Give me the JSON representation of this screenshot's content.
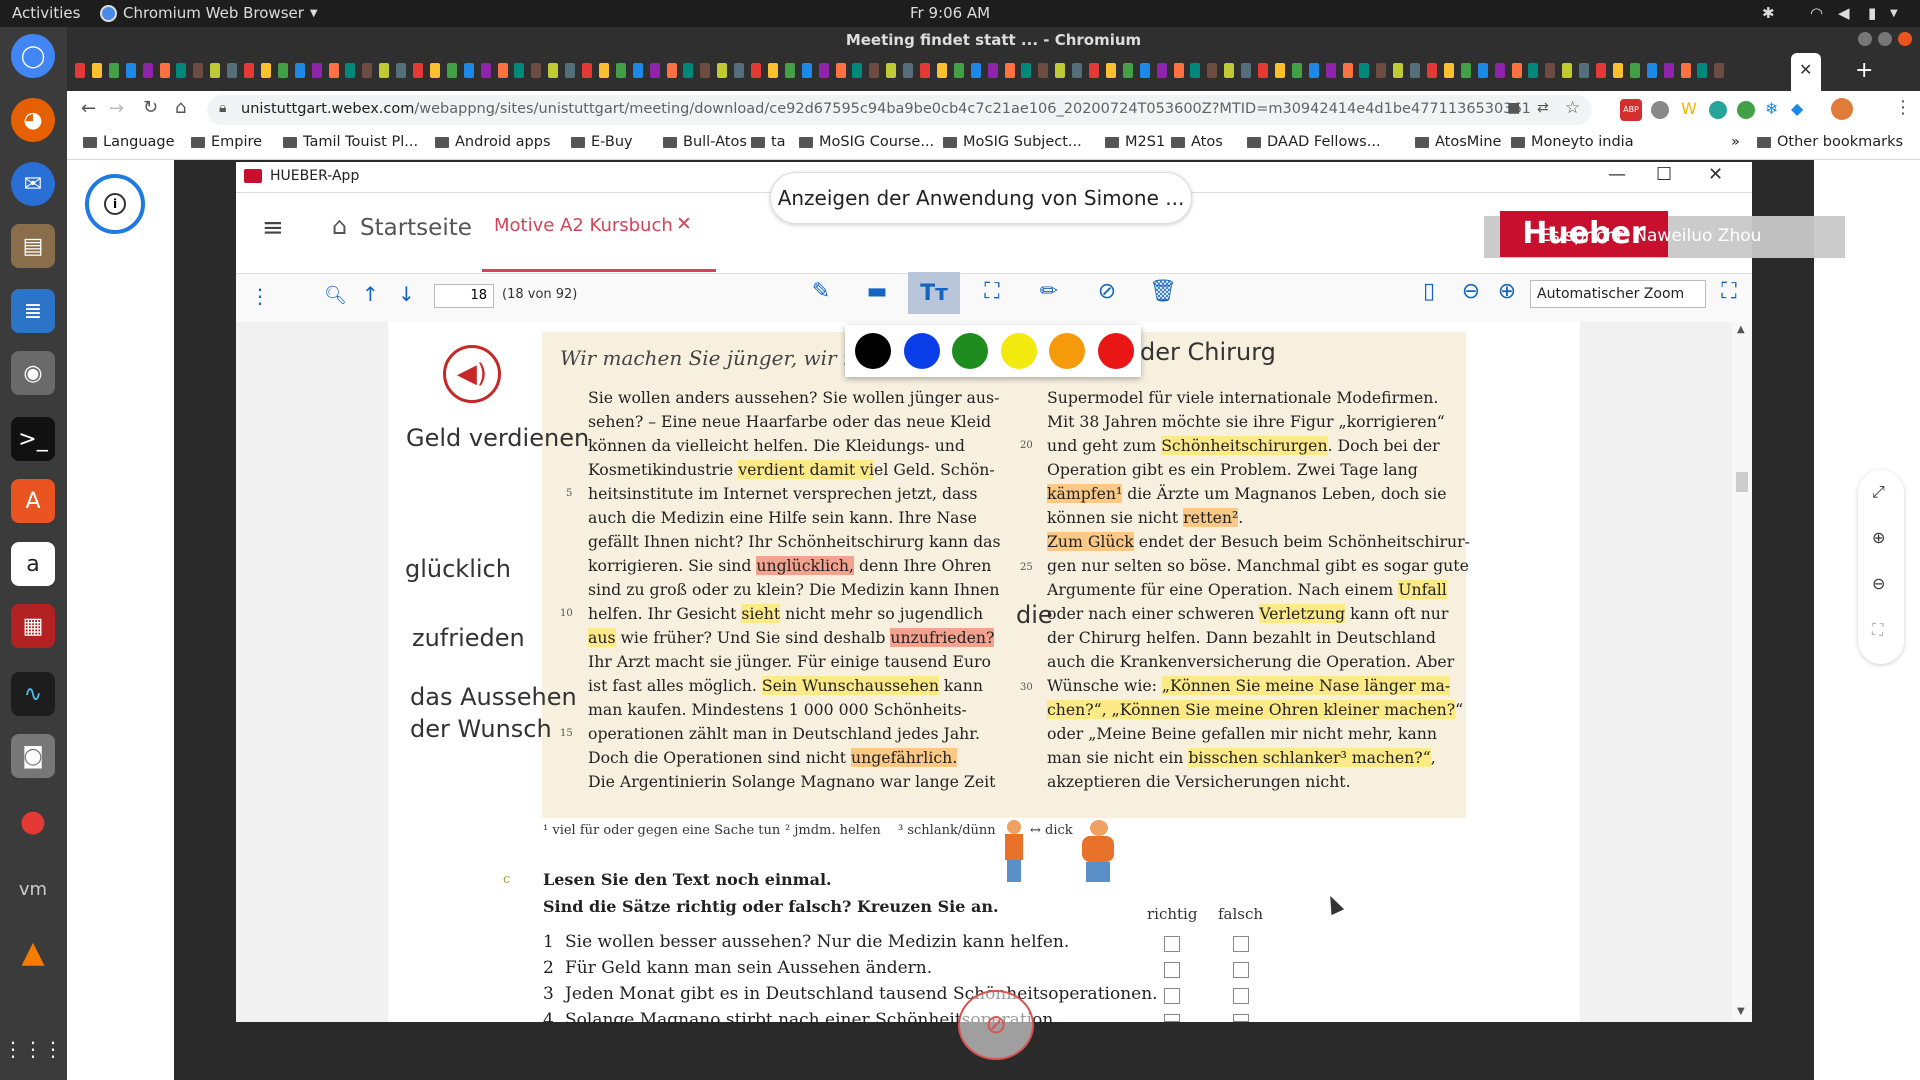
{
  "system_bar": {
    "activities": "Activities",
    "app_menu": "Chromium Web Browser",
    "clock": "Fr  9:06 AM"
  },
  "browser": {
    "window_title": "Meeting findet statt ... - Chromium",
    "url_domain": "unistuttgart.webex.com",
    "url_path": "/webappng/sites/unistuttgart/meeting/download/ce92d67595c94ba9be0cb4c7c21ae106_20200724T053600Z?MTID=m30942414e4d1be477113653036162165&launchApp...",
    "bookmarks": [
      "Language",
      "Empire",
      "Tamil Touist Pl...",
      "Android apps",
      "E-Buy",
      "Bull-Atos",
      "ta",
      "MoSIG Course...",
      "MoSIG Subject...",
      "M2S1",
      "Atos",
      "DAAD Fellows...",
      "AtosMine",
      "Moneyto india"
    ],
    "more_bookmarks": "»",
    "other_bookmarks": "Other bookmarks"
  },
  "webex": {
    "share_banner": "Anzeigen der Anwendung von Simone ...",
    "speaking": "Es spricht: Naweiluo Zhou",
    "hueber_badge": "Hueber",
    "info_icon": "i"
  },
  "app": {
    "window_title": "HUEBER-App",
    "home": "Startseite",
    "tab_label": "Motive A2 Kursbuch",
    "page_number": "18",
    "page_count": "(18 von 92)",
    "zoom": "Automatischer Zoom",
    "color_swatches": [
      "#000000",
      "#0a3ee8",
      "#1e8c1e",
      "#f2ea0f",
      "#f59a0a",
      "#ea1515"
    ]
  },
  "document": {
    "heading_left": "Wir machen Sie jünger, wir m",
    "heading_right": "der Chirurg",
    "side_words": [
      "Geld verdienen",
      "glücklich",
      "zufrieden",
      "das Aussehen",
      "der Wunsch",
      "die"
    ],
    "left_lines": [
      "Sie wollen anders aussehen? Sie wollen jünger aus-",
      "sehen? – Eine neue Haarfarbe oder das neue Kleid",
      "können da vielleicht helfen. Die Kleidungs- und",
      "Kosmetikindustrie verdient damit viel Geld. Schön-",
      "heitsinstitute im Internet versprechen jetzt, dass",
      "auch die Medizin eine Hilfe sein kann. Ihre Nase",
      "gefällt Ihnen nicht? Ihr Schönheitschirurg kann das",
      "korrigieren. Sie sind unglücklich, denn Ihre Ohren",
      "sind zu groß oder zu klein? Die Medizin kann Ihnen",
      "helfen. Ihr Gesicht sieht nicht mehr so jugendlich",
      "aus wie früher? Und Sie sind deshalb unzufrieden?",
      "Ihr Arzt macht sie jünger. Für einige tausend Euro",
      "ist fast alles möglich. Sein Wunschaussehen kann",
      "man kaufen. Mindestens 1 000 000 Schönheits-",
      "operationen zählt man in Deutschland jedes Jahr.",
      "Doch die Operationen sind nicht ungefährlich.",
      "Die Argentinierin Solange Magnano war lange Zeit"
    ],
    "right_lines": [
      "Supermodel für viele internationale Modefirmen.",
      "Mit 38 Jahren möchte sie ihre Figur „korrigieren“",
      "und geht zum Schönheitschirurgen. Doch bei der",
      "Operation gibt es ein Problem. Zwei Tage lang",
      "kämpfen¹ die Ärzte um Magnanos Leben, doch sie",
      "können sie nicht retten².",
      "Zum Glück endet der Besuch beim Schönheitschirur-",
      "gen nur selten so böse. Manchmal gibt es sogar gute",
      "Argumente für eine Operation. Nach einem Unfall",
      "oder nach einer schweren Verletzung kann oft nur",
      "der Chirurg helfen. Dann bezahlt in Deutschland",
      "auch die Krankenversicherung die Operation. Aber",
      "Wünsche wie: „Können Sie meine Nase länger ma-",
      "chen?“, „Können Sie meine Ohren kleiner machen?“",
      "oder „Meine Beine gefallen mir nicht mehr, kann",
      "man sie nicht ein bisschen schlanker³ machen?“,",
      "akzeptieren die Versicherungen nicht."
    ],
    "line_numbers_left": [
      "5",
      "10",
      "15"
    ],
    "line_numbers_right": [
      "20",
      "25",
      "30"
    ],
    "footnote1": "¹ viel für oder gegen eine Sache tun",
    "footnote2": "² jmdm. helfen",
    "footnote3": "³ schlank/dünn",
    "footnote_arrow": "↔ dick",
    "exercise_letter": "c",
    "exercise_line1": "Lesen Sie den Text noch einmal.",
    "exercise_line2": "Sind die Sätze richtig oder falsch? Kreuzen Sie an.",
    "col_true": "richtig",
    "col_false": "falsch",
    "statements": [
      {
        "n": "1",
        "text": "Sie wollen besser aussehen? Nur die Medizin kann helfen."
      },
      {
        "n": "2",
        "text": "Für Geld kann man sein Aussehen ändern."
      },
      {
        "n": "3",
        "text": "Jeden Monat gibt es in Deutschland tausend Schönheitsoperationen."
      },
      {
        "n": "4",
        "text": "Solange Magnano stirbt nach einer Schönheitsoperation."
      }
    ]
  }
}
